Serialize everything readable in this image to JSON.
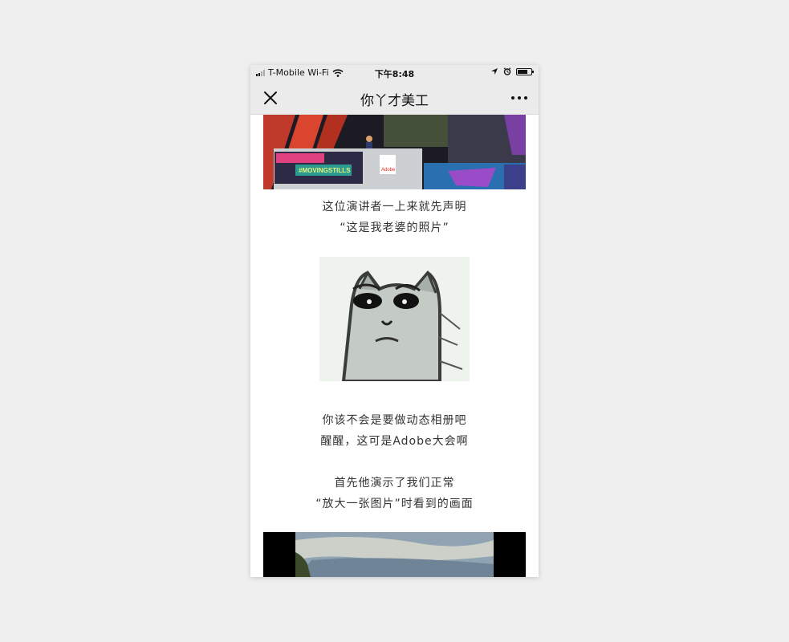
{
  "statusbar": {
    "carrier": "T-Mobile Wi-Fi",
    "time": "下午8:48"
  },
  "navbar": {
    "title": "你丫才美工"
  },
  "article": {
    "top_image": {
      "label": "#MOVINGSTILLS",
      "brand": "Adobe"
    },
    "caption1_line1": "这位演讲者一上来就先声明",
    "caption1_line2": "“这是我老婆的照片”",
    "caption2_line1": "你该不会是要做动态相册吧",
    "caption2_line2": "醒醒，这可是Adobe大会啊",
    "caption3_line1": "首先他演示了我们正常",
    "caption3_line2": "“放大一张图片”时看到的画面"
  },
  "colors": {
    "background": "#efefef",
    "navbar": "#ebebeb",
    "text": "#333333"
  }
}
